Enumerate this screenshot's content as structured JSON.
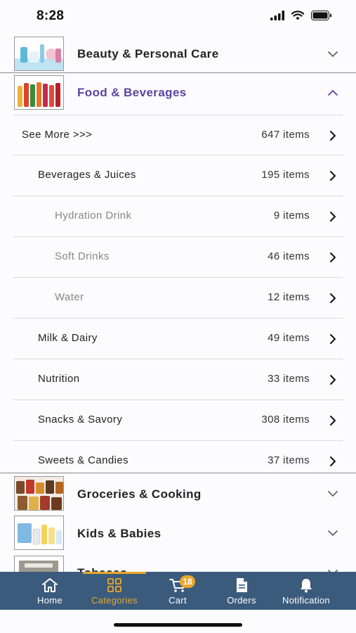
{
  "status": {
    "time": "8:28"
  },
  "categories": [
    {
      "label": "Beauty & Personal Care",
      "expanded": false
    },
    {
      "label": "Food & Beverages",
      "expanded": true
    },
    {
      "label": "Groceries & Cooking",
      "expanded": false
    },
    {
      "label": "Kids & Babies",
      "expanded": false
    },
    {
      "label": "Tobacco",
      "expanded": false
    }
  ],
  "subcategories": [
    {
      "label": "See More >>>",
      "count": "647 items",
      "level": 0
    },
    {
      "label": "Beverages & Juices",
      "count": "195 items",
      "level": 1
    },
    {
      "label": "Hydration Drink",
      "count": "9 items",
      "level": 2
    },
    {
      "label": "Soft Drinks",
      "count": "46 items",
      "level": 2
    },
    {
      "label": "Water",
      "count": "12 items",
      "level": 2
    },
    {
      "label": "Milk & Dairy",
      "count": "49 items",
      "level": 1
    },
    {
      "label": "Nutrition",
      "count": "33 items",
      "level": 1
    },
    {
      "label": "Snacks & Savory",
      "count": "308 items",
      "level": 1
    },
    {
      "label": "Sweets & Candies",
      "count": "37 items",
      "level": 1
    }
  ],
  "tabbar": {
    "home": "Home",
    "categories": "Categories",
    "cart": "Cart",
    "cart_badge": "18",
    "orders": "Orders",
    "notification": "Notification"
  },
  "colors": {
    "accent": "#5b45a0",
    "tabbar": "#3b5b7c",
    "tab_active": "#e8a72c"
  }
}
